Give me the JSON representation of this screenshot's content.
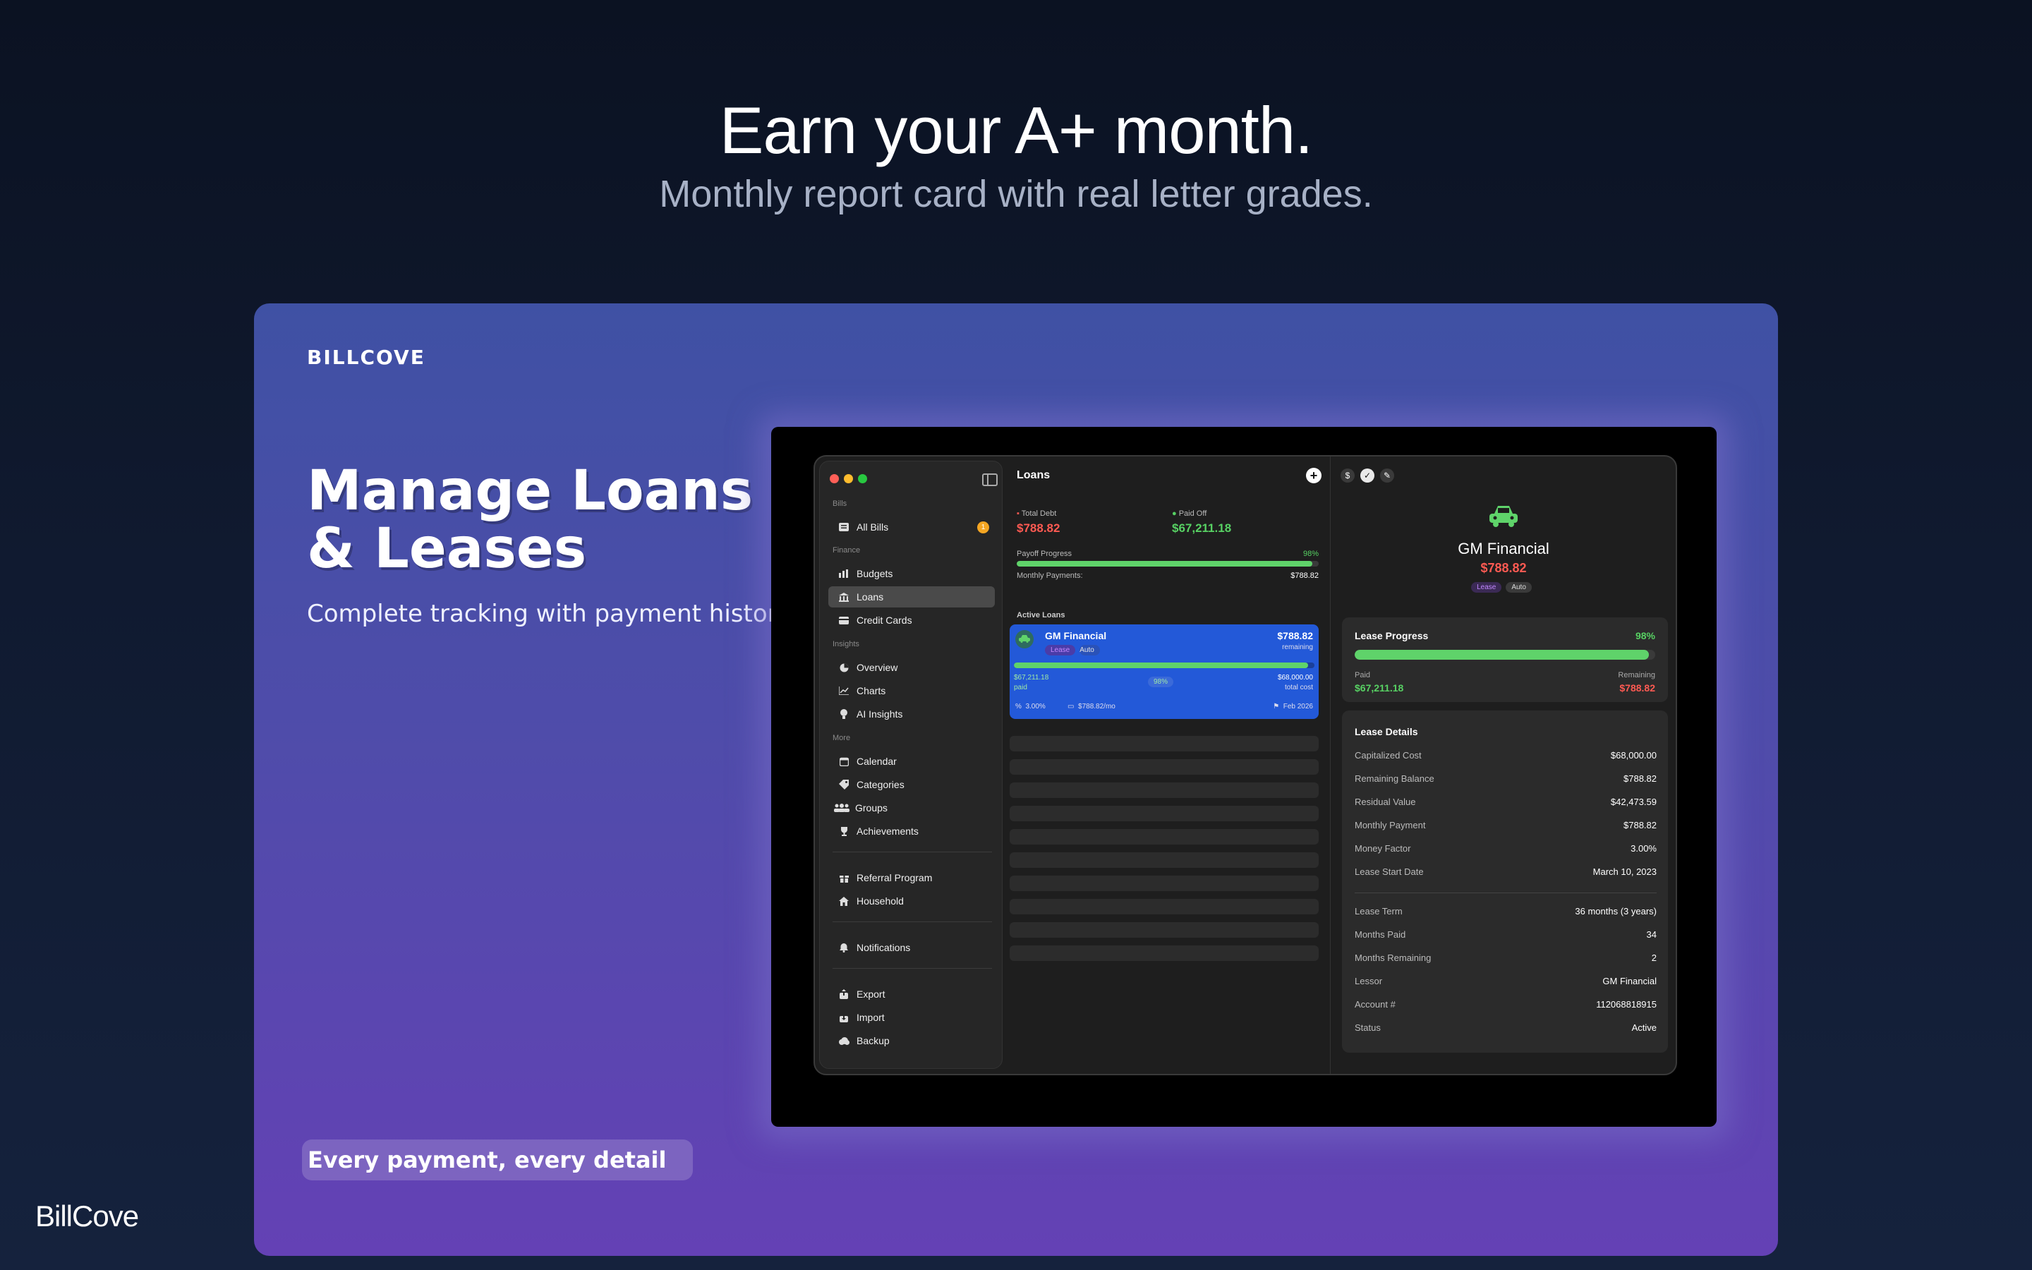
{
  "hero": {
    "title": "Earn your A+ month.",
    "subtitle": "Monthly report card with real letter grades."
  },
  "card": {
    "brand": "BILLCOVE",
    "title": "Manage Loans & Leases",
    "subtitle": "Complete tracking with payment history",
    "pill": "Every payment, every detail"
  },
  "footer_brand": "BillCove",
  "app": {
    "sidebar": {
      "sections": [
        {
          "label": "Bills",
          "items": [
            {
              "label": "All Bills",
              "icon": "list-icon",
              "badge": "1"
            }
          ]
        },
        {
          "label": "Finance",
          "items": [
            {
              "label": "Budgets",
              "icon": "bar-chart-icon"
            },
            {
              "label": "Loans",
              "icon": "bank-icon",
              "active": true
            },
            {
              "label": "Credit Cards",
              "icon": "credit-card-icon"
            }
          ]
        },
        {
          "label": "Insights",
          "items": [
            {
              "label": "Overview",
              "icon": "pie-icon"
            },
            {
              "label": "Charts",
              "icon": "line-chart-icon"
            },
            {
              "label": "AI Insights",
              "icon": "bulb-icon"
            }
          ]
        },
        {
          "label": "More",
          "items": [
            {
              "label": "Calendar",
              "icon": "calendar-icon"
            },
            {
              "label": "Categories",
              "icon": "tag-icon"
            },
            {
              "label": "Groups",
              "icon": "people-icon"
            },
            {
              "label": "Achievements",
              "icon": "trophy-icon"
            }
          ]
        }
      ],
      "extra": [
        {
          "label": "Referral Program",
          "icon": "gift-icon"
        },
        {
          "label": "Household",
          "icon": "house-icon"
        },
        {
          "label": "Notifications",
          "icon": "bell-icon"
        },
        {
          "label": "Export",
          "icon": "export-icon"
        },
        {
          "label": "Import",
          "icon": "import-icon"
        },
        {
          "label": "Backup",
          "icon": "cloud-icon"
        }
      ]
    },
    "loans": {
      "title": "Loans",
      "total_debt_label": "Total Debt",
      "total_debt": "$788.82",
      "paid_off_label": "Paid Off",
      "paid_off": "$67,211.18",
      "payoff_label": "Payoff Progress",
      "payoff_pct": "98%",
      "payoff_fraction": 0.98,
      "monthly_label": "Monthly Payments:",
      "monthly_value": "$788.82",
      "active_label": "Active Loans",
      "card": {
        "name": "GM Financial",
        "tag_type": "Lease",
        "tag_cat": "Auto",
        "remaining_value": "$788.82",
        "remaining_label": "remaining",
        "paid_value": "$67,211.18",
        "paid_label": "paid",
        "pct": "98%",
        "total_value": "$68,000.00",
        "total_label": "total cost",
        "rate": "3.00%",
        "monthly": "$788.82/mo",
        "end": "Feb 2026"
      }
    },
    "detail": {
      "name": "GM Financial",
      "amount": "$788.82",
      "tag_type": "Lease",
      "tag_cat": "Auto",
      "progress_title": "Lease Progress",
      "progress_pct": "98%",
      "progress_fraction": 0.98,
      "paid_label": "Paid",
      "paid_value": "$67,211.18",
      "remaining_label": "Remaining",
      "remaining_value": "$788.82",
      "details_title": "Lease Details",
      "rows_a": [
        {
          "k": "Capitalized Cost",
          "v": "$68,000.00"
        },
        {
          "k": "Remaining Balance",
          "v": "$788.82"
        },
        {
          "k": "Residual Value",
          "v": "$42,473.59"
        },
        {
          "k": "Monthly Payment",
          "v": "$788.82"
        },
        {
          "k": "Money Factor",
          "v": "3.00%"
        },
        {
          "k": "Lease Start Date",
          "v": "March 10, 2023"
        }
      ],
      "rows_b": [
        {
          "k": "Lease Term",
          "v": "36 months (3 years)"
        },
        {
          "k": "Months Paid",
          "v": "34"
        },
        {
          "k": "Months Remaining",
          "v": "2"
        },
        {
          "k": "Lessor",
          "v": "GM Financial"
        },
        {
          "k": "Account #",
          "v": "112068818915"
        },
        {
          "k": "Status",
          "v": "Active"
        }
      ]
    }
  },
  "colors": {
    "accent_green": "#57d163",
    "accent_red": "#ff5a52",
    "card_blue": "#2359d8"
  }
}
